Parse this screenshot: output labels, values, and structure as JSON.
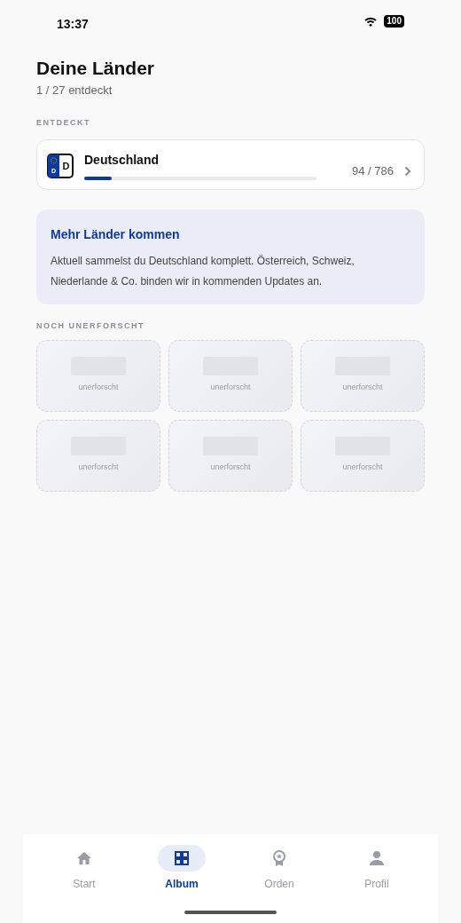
{
  "status_bar": {
    "time": "13:37",
    "battery": "100"
  },
  "header": {
    "title": "Deine Länder",
    "subtitle": "1 / 27 entdeckt"
  },
  "discovered": {
    "heading": "ENTDECKT",
    "items": [
      {
        "name": "Deutschland",
        "plate_badge": "D",
        "plate_code": "D",
        "count": "94 / 786",
        "level": 0.12
      }
    ]
  },
  "info": {
    "title": "Mehr Länder kommen",
    "text": "Aktuell sammelst du Deutschland komplett. Österreich, Schweiz, Niederlande & Co. binden wir in kommenden Updates an."
  },
  "unexplored": {
    "heading": "NOCH UNERFORSCHT",
    "tiles": [
      {
        "label": "unerforscht"
      },
      {
        "label": "unerforscht"
      },
      {
        "label": "unerforscht"
      },
      {
        "label": "unerforscht"
      },
      {
        "label": "unerforscht"
      },
      {
        "label": "unerforscht"
      }
    ]
  },
  "tab_bar": [
    {
      "kind": "home",
      "label": "Start",
      "selected": false
    },
    {
      "kind": "grid",
      "label": "Album",
      "selected": true
    },
    {
      "kind": "medal",
      "label": "Orden",
      "selected": false
    },
    {
      "kind": "person",
      "label": "Profil",
      "selected": false
    }
  ]
}
